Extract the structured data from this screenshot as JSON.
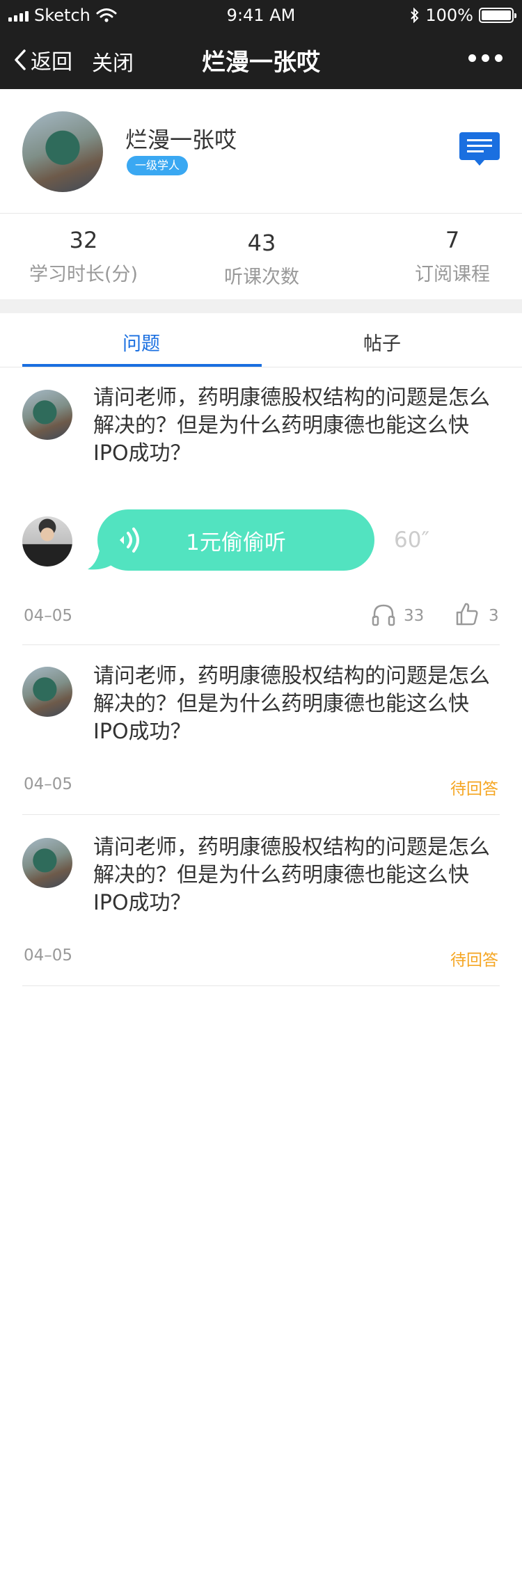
{
  "status_bar": {
    "carrier": "Sketch",
    "time": "9:41 AM",
    "battery": "100%"
  },
  "nav": {
    "back_label": "返回",
    "close_label": "关闭",
    "title": "烂漫一张哎"
  },
  "profile": {
    "name": "烂漫一张哎",
    "badge": "一级学人"
  },
  "stats": [
    {
      "value": "32",
      "label": "学习时长(分)"
    },
    {
      "value": "43",
      "label": "听课次数"
    },
    {
      "value": "7",
      "label": "订阅课程"
    }
  ],
  "tabs": [
    {
      "label": "问题"
    },
    {
      "label": "帖子"
    }
  ],
  "items": [
    {
      "question": "请问老师，药明康德股权结构的问题是怎么解决的？但是为什么药明康德也能这么快IPO成功？",
      "answer_label": "1元偷偷听",
      "duration": "60″",
      "date": "04–05",
      "listens": "33",
      "likes": "3"
    },
    {
      "question": "请问老师，药明康德股权结构的问题是怎么解决的？但是为什么药明康德也能这么快IPO成功？",
      "date": "04–05",
      "status": "待回答"
    },
    {
      "question": "请问老师，药明康德股权结构的问题是怎么解决的？但是为什么药明康德也能这么快IPO成功？",
      "date": "04–05",
      "status": "待回答"
    }
  ],
  "colors": {
    "accent": "#1a6fe0",
    "badge": "#3aa8f2",
    "answer_bubble": "#52e3c0",
    "pending": "#f5a623",
    "nav_bg": "#1f1f1f"
  },
  "icons": {
    "back": "chevron-left-icon",
    "more": "more-dots-icon",
    "message": "message-icon",
    "sound": "sound-wave-icon",
    "listen": "headphones-icon",
    "like": "thumbs-up-icon"
  }
}
